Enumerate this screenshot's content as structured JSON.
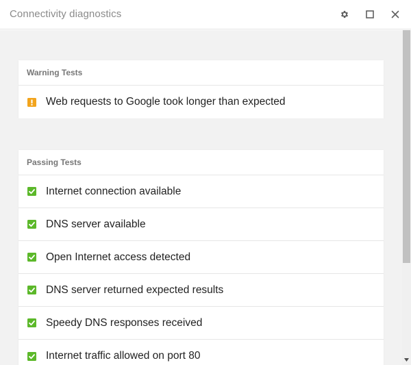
{
  "window": {
    "title": "Connectivity diagnostics",
    "controls": {
      "settings_icon": "gear-icon",
      "maximize_icon": "maximize-icon",
      "close_icon": "close-icon"
    }
  },
  "colors": {
    "warning": "#f2a41d",
    "pass": "#5cb82a",
    "background": "#f2f2f2"
  },
  "warning_section": {
    "header": "Warning Tests",
    "items": [
      {
        "label": "Web requests to Google took longer than expected",
        "icon": "warning-icon"
      }
    ]
  },
  "passing_section": {
    "header": "Passing Tests",
    "items": [
      {
        "label": "Internet connection available",
        "icon": "check-icon"
      },
      {
        "label": "DNS server available",
        "icon": "check-icon"
      },
      {
        "label": "Open Internet access detected",
        "icon": "check-icon"
      },
      {
        "label": "DNS server returned expected results",
        "icon": "check-icon"
      },
      {
        "label": "Speedy DNS responses received",
        "icon": "check-icon"
      },
      {
        "label": "Internet traffic allowed on port 80",
        "icon": "check-icon"
      }
    ]
  }
}
